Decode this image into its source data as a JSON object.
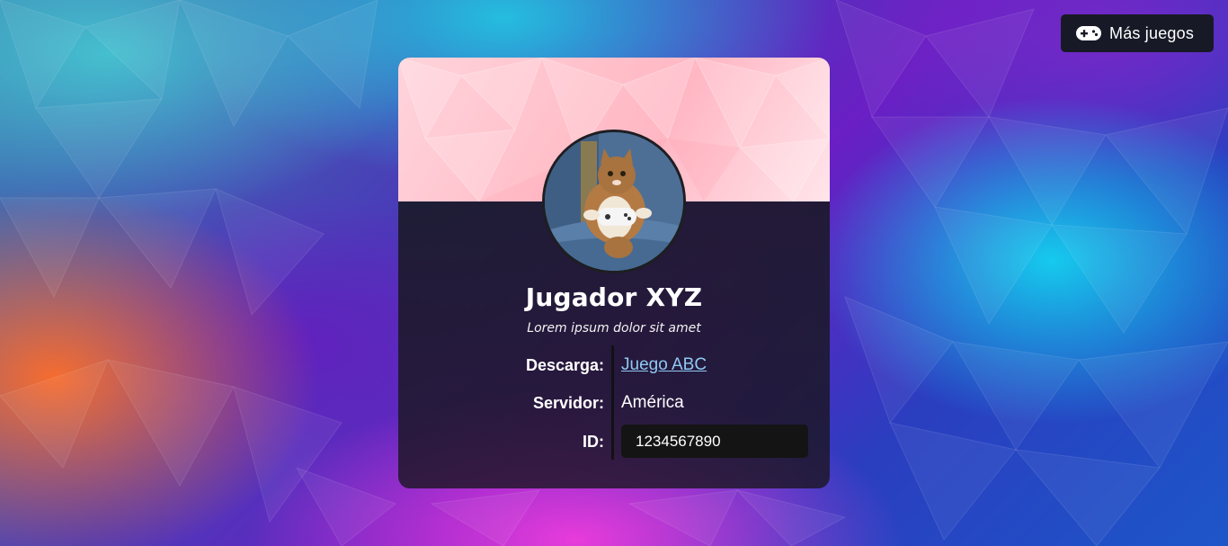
{
  "header": {
    "more_games_label": "Más juegos",
    "more_games_icon": "gamepad-icon"
  },
  "profile": {
    "avatar_icon": "cat-with-controller-avatar",
    "name": "Jugador XYZ",
    "tagline": "Lorem ipsum dolor sit amet"
  },
  "details": {
    "download_label": "Descarga:",
    "download_value": "Juego ABC",
    "server_label": "Servidor:",
    "server_value": "América",
    "id_label": "ID:",
    "id_value": "1234567890"
  },
  "colors": {
    "card_top": "#ffc0ca",
    "card_body": "#1c1624",
    "link": "#8fc9f2",
    "button_bg": "#171a26"
  }
}
